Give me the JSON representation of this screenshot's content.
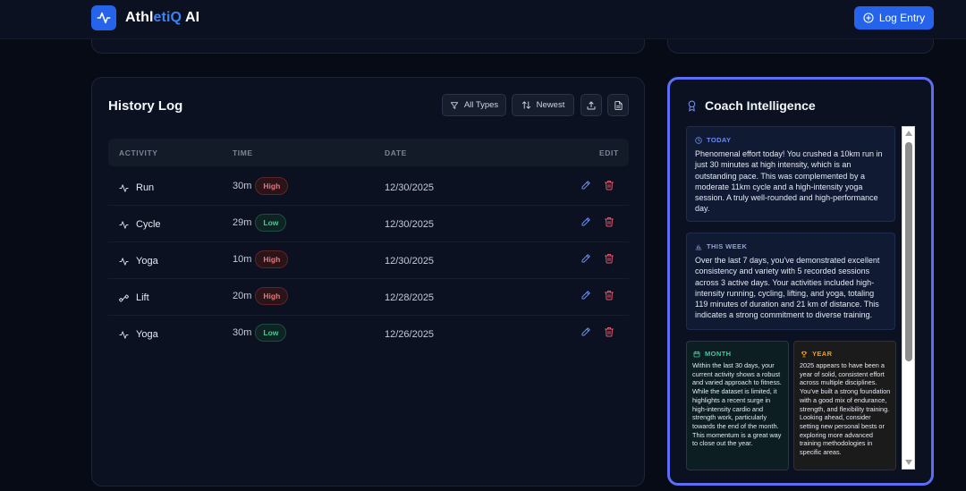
{
  "app": {
    "name_part1": "Athl",
    "name_part2": "etiQ",
    "name_part3": " AI",
    "log_entry_label": "Log Entry"
  },
  "history": {
    "title": "History Log",
    "filter_label": "All Types",
    "sort_label": "Newest",
    "columns": [
      "ACTIVITY",
      "TIME",
      "DATE",
      "EDIT"
    ],
    "rows": [
      {
        "activity": "Run",
        "icon": "activity-icon",
        "time": "30m",
        "intensity": "High",
        "date": "12/30/2025"
      },
      {
        "activity": "Cycle",
        "icon": "activity-icon",
        "time": "29m",
        "intensity": "Low",
        "date": "12/30/2025"
      },
      {
        "activity": "Yoga",
        "icon": "activity-icon",
        "time": "10m",
        "intensity": "High",
        "date": "12/30/2025"
      },
      {
        "activity": "Lift",
        "icon": "dumbbell-icon",
        "time": "20m",
        "intensity": "High",
        "date": "12/28/2025"
      },
      {
        "activity": "Yoga",
        "icon": "activity-icon",
        "time": "30m",
        "intensity": "Low",
        "date": "12/26/2025"
      }
    ]
  },
  "coach": {
    "title": "Coach Intelligence",
    "today": {
      "label": "TODAY",
      "text": "Phenomenal effort today! You crushed a 10km run in just 30 minutes at high intensity, which is an outstanding pace. This was complemented by a moderate 11km cycle and a high-intensity yoga session. A truly well-rounded and high-performance day."
    },
    "week": {
      "label": "THIS WEEK",
      "text": "Over the last 7 days, you've demonstrated excellent consistency and variety with 5 recorded sessions across 3 active days. Your activities included high-intensity running, cycling, lifting, and yoga, totaling 119 minutes of duration and 21 km of distance. This indicates a strong commitment to diverse training."
    },
    "month": {
      "label": "MONTH",
      "text": "Within the last 30 days, your current activity shows a robust and varied approach to fitness. While the dataset is limited, it highlights a recent surge in high-intensity cardio and strength work, particularly towards the end of the month. This momentum is a great way to close out the year."
    },
    "year": {
      "label": "YEAR",
      "text": "2025 appears to have been a year of solid, consistent effort across multiple disciplines. You've built a strong foundation with a good mix of endurance, strength, and flexibility training. Looking ahead, consider setting new personal bests or exploring more advanced training methodologies in specific areas."
    }
  },
  "colors": {
    "accent": "#2563eb",
    "coach_border": "#5b6ef5",
    "high": "#f0727a",
    "low": "#3fcf95",
    "month": "#34d399",
    "year": "#f59e0b"
  }
}
